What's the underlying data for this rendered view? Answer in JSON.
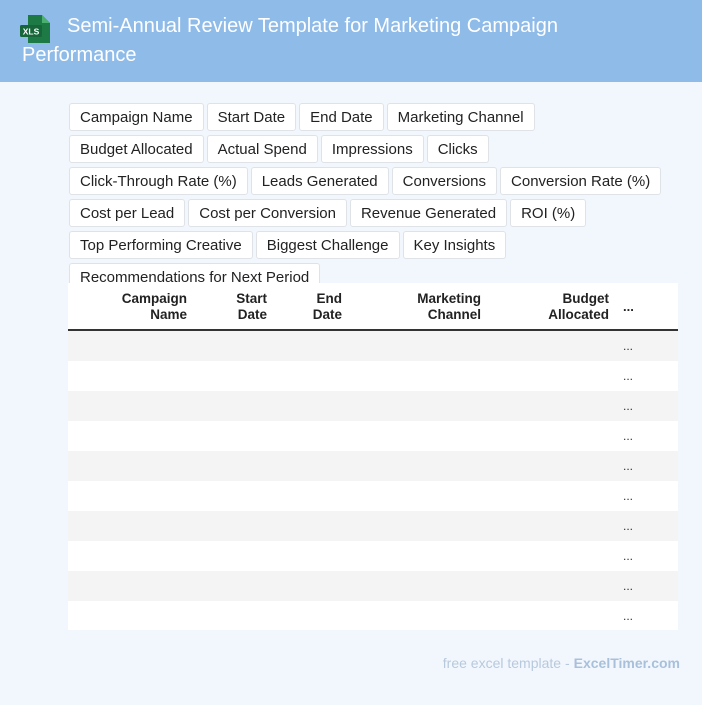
{
  "header": {
    "title": "Semi-Annual Review Template for Marketing Campaign Performance",
    "icon_label": "XLS",
    "color": "#8fbbe9",
    "icon_color": "#1d7a45"
  },
  "fields": [
    "Campaign Name",
    "Start Date",
    "End Date",
    "Marketing Channel",
    "Budget Allocated",
    "Actual Spend",
    "Impressions",
    "Clicks",
    "Click-Through Rate (%)",
    "Leads Generated",
    "Conversions",
    "Conversion Rate (%)",
    "Cost per Lead",
    "Cost per Conversion",
    "Revenue Generated",
    "ROI (%)",
    "Top Performing Creative",
    "Biggest Challenge",
    "Key Insights",
    "Recommendations for Next Period"
  ],
  "table": {
    "columns": [
      {
        "line1": "Campaign",
        "line2": "Name"
      },
      {
        "line1": "Start",
        "line2": "Date"
      },
      {
        "line1": "End",
        "line2": "Date"
      },
      {
        "line1": "Marketing",
        "line2": "Channel"
      },
      {
        "line1": "Budget",
        "line2": "Allocated"
      }
    ],
    "more": "...",
    "row_ellipsis": [
      "...",
      "...",
      "...",
      "...",
      "...",
      "...",
      "...",
      "...",
      "...",
      "..."
    ]
  },
  "footer": {
    "text": "free excel template -",
    "brand": "ExcelTimer.com"
  }
}
